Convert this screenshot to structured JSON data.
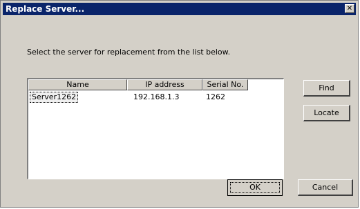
{
  "window": {
    "title": "Replace Server..."
  },
  "titlebar": {
    "close_glyph": "✕"
  },
  "prompt": "Select the server for replacement from the list below.",
  "table": {
    "columns": [
      "Name",
      "IP address",
      "Serial No."
    ],
    "rows": [
      {
        "name": "Server1262",
        "ip": "192.168.1.3",
        "serial": "1262"
      }
    ]
  },
  "buttons": {
    "find": "Find",
    "locate": "Locate",
    "ok": "OK",
    "cancel": "Cancel"
  }
}
